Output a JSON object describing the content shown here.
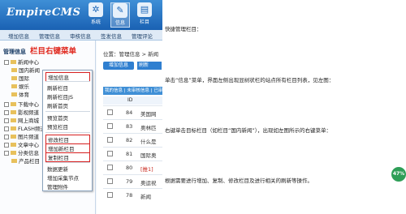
{
  "app": {
    "logo": "EmpireCMS",
    "top_icons": [
      {
        "label": "系统",
        "icon": "gear-icon",
        "glyph": "✲"
      },
      {
        "label": "信息",
        "icon": "edit-icon",
        "glyph": "✎"
      },
      {
        "label": "栏目",
        "icon": "folder-icon",
        "glyph": "▤"
      }
    ],
    "menu": [
      "增加信息",
      "管理信息",
      "审核信息",
      "签发信息",
      "管理评论"
    ]
  },
  "tree": {
    "title": "管理信息",
    "annotation": "栏目右键菜单",
    "nodes": [
      {
        "label": "新闻中心"
      },
      {
        "label": "国内新闻"
      },
      {
        "label": "国际"
      },
      {
        "label": "娱乐"
      },
      {
        "label": "体育"
      },
      {
        "label": "下载中心"
      },
      {
        "label": "影视频道"
      },
      {
        "label": "网上商城"
      },
      {
        "label": "FLASH频道"
      },
      {
        "label": "图片频道"
      },
      {
        "label": "文章中心"
      },
      {
        "label": "分类信息"
      },
      {
        "label": "产品栏目"
      }
    ]
  },
  "context_menu": {
    "items": [
      {
        "label": "增加信息",
        "highlighted": true
      },
      {
        "label": "刷新栏目",
        "highlighted": false
      },
      {
        "label": "刷新栏目JS",
        "highlighted": false
      },
      {
        "label": "刷新首页",
        "highlighted": false
      },
      {
        "label": "预览首页",
        "highlighted": false
      },
      {
        "label": "预览栏目",
        "highlighted": false
      },
      {
        "label": "修改栏目",
        "highlighted": true
      },
      {
        "label": "增加新栏目",
        "highlighted": true
      },
      {
        "label": "复制栏目",
        "highlighted": true
      },
      {
        "label": "数据更新",
        "highlighted": false
      },
      {
        "label": "增加采集节点",
        "highlighted": false
      },
      {
        "label": "管理附件",
        "highlighted": false
      }
    ]
  },
  "content": {
    "position": "位置：管理信息 > 新闻",
    "add_button": "增加信息",
    "second_button": "刷新",
    "table_header": "我的信息 | 未审核信息 | 已审",
    "id_column": "ID",
    "rows": [
      {
        "id": "84",
        "title": "美国网",
        "red": false
      },
      {
        "id": "83",
        "title": "奥林匹",
        "red": false
      },
      {
        "id": "82",
        "title": "什么是",
        "red": false
      },
      {
        "id": "81",
        "title": "国际奥",
        "red": false
      },
      {
        "id": "80",
        "title": "[推1]",
        "red": true
      },
      {
        "id": "79",
        "title": "奥运祝",
        "red": false
      },
      {
        "id": "78",
        "title": "新闻",
        "red": false
      }
    ]
  },
  "instructions": [
    "快捷管理栏目：",
    "单击“信息”菜单，界面左侧出现显树状栏的站点所有栏目列表，见左图：",
    "右键单击目标栏目（如栏目“国内新闻”），出现如左图所示的右键菜单：",
    "根据需要进行增加、复制、修改栏目及进行相关的刷新等操作。"
  ],
  "progress_badge": "47%"
}
